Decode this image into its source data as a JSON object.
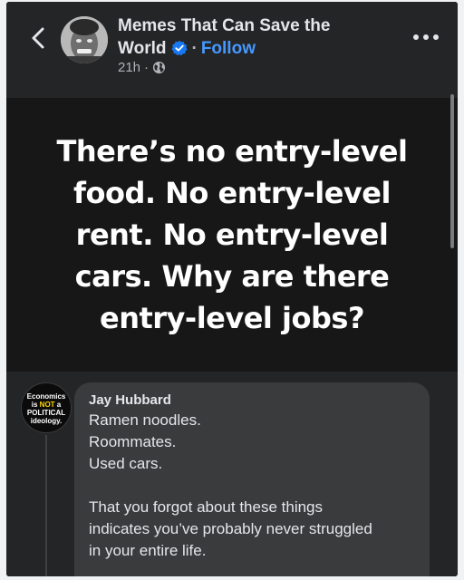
{
  "header": {
    "page_name_line1": "Memes That Can Save the",
    "page_name_line2": "World",
    "follow_label": "Follow",
    "separator": "·",
    "time": "21h",
    "verified_icon": "verified-badge-icon",
    "audience_icon": "globe-icon",
    "back_icon": "chevron-left-icon",
    "more_icon": "more-horizontal-icon"
  },
  "post": {
    "text_lines": [
      "There’s no entry-level",
      "food. No entry-level",
      "rent. No entry-level",
      "cars. Why are there",
      "entry-level jobs?"
    ]
  },
  "comment": {
    "avatar_text": {
      "line1": "Economics",
      "line2_a": "is ",
      "line2_b": "NOT",
      "line2_c": " a",
      "line3": "POLITICAL",
      "line4": "ideology."
    },
    "author": "Jay Hubbard",
    "lines": [
      "Ramen noodles.",
      "Roommates.",
      "Used cars."
    ],
    "lines2": [
      "That you forgot about these things",
      "indicates you’ve probably never struggled",
      "in your entire life."
    ]
  },
  "colors": {
    "background": "#242526",
    "image_background": "#171717",
    "bubble": "#3a3b3c",
    "accent": "#4599ff",
    "highlight": "#ffd400"
  }
}
